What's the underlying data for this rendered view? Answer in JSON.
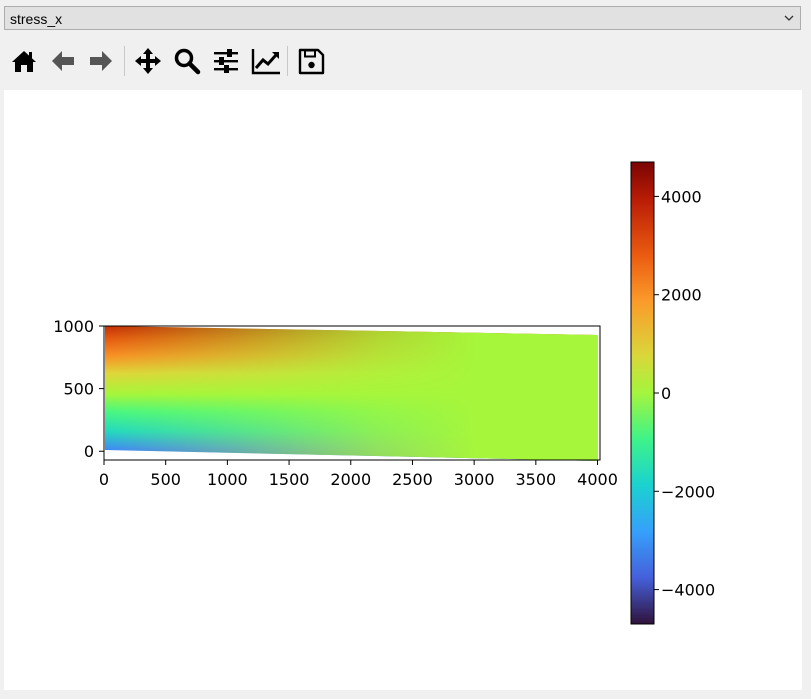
{
  "dropdown": {
    "selected": "stress_x"
  },
  "toolbar": {
    "buttons": [
      {
        "name": "home-button",
        "icon": "home-icon"
      },
      {
        "name": "back-button",
        "icon": "arrow-left-icon"
      },
      {
        "name": "forward-button",
        "icon": "arrow-right-icon"
      },
      {
        "name": "pan-button",
        "icon": "move-icon"
      },
      {
        "name": "zoom-button",
        "icon": "magnifier-icon"
      },
      {
        "name": "configure-subplots-button",
        "icon": "sliders-icon"
      },
      {
        "name": "edit-axis-button",
        "icon": "line-chart-icon"
      },
      {
        "name": "save-button",
        "icon": "floppy-disk-icon"
      }
    ]
  },
  "chart_data": {
    "type": "heatmap",
    "title": "",
    "xlabel": "",
    "ylabel": "",
    "xlim": [
      0,
      4020
    ],
    "ylim": [
      -70,
      1000
    ],
    "x_ticks": [
      "0",
      "500",
      "1000",
      "1500",
      "2000",
      "2500",
      "3000",
      "3500",
      "4000"
    ],
    "y_ticks": [
      "0",
      "500",
      "1000"
    ],
    "colormap": "turbo",
    "colorbar": {
      "range": [
        -4700,
        4700
      ],
      "ticks": [
        "4000",
        "2000",
        "0",
        "−2000",
        "−4000"
      ],
      "tick_values": [
        4000,
        2000,
        0,
        -2000,
        -4000
      ]
    },
    "field": {
      "description": "stress_x over deformed beam",
      "top_left_value": 4000,
      "bottom_left_value": -4000,
      "right_end_value": 0
    }
  }
}
